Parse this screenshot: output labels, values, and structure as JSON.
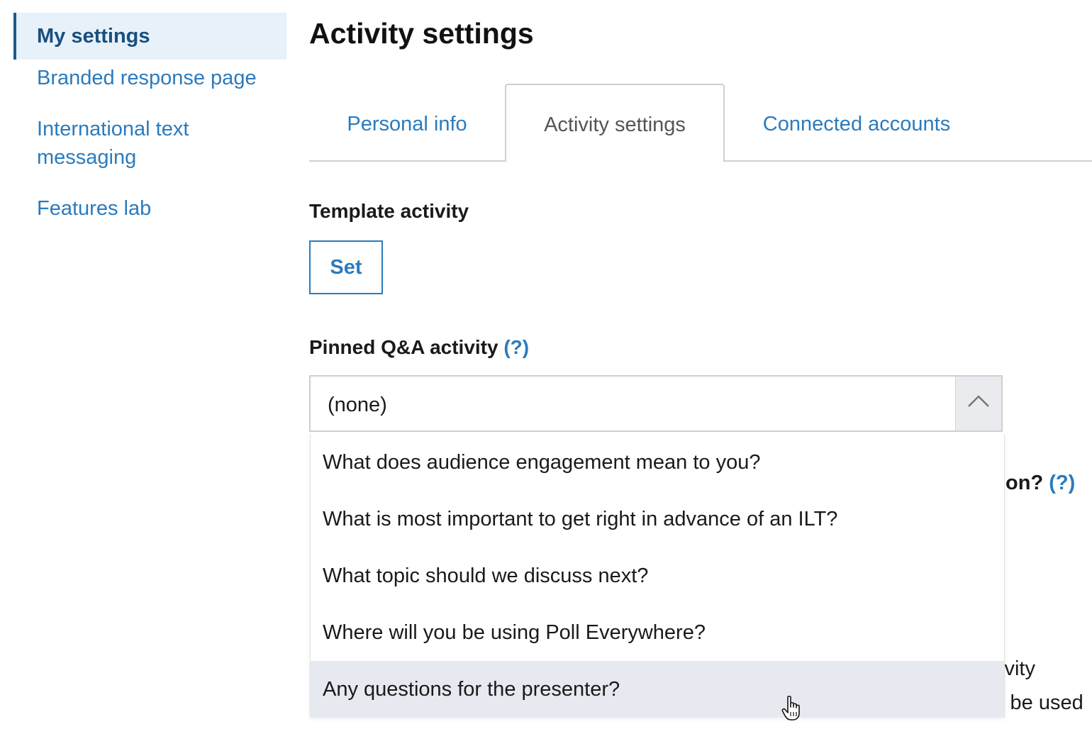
{
  "sidebar": {
    "items": [
      {
        "label": "My settings"
      },
      {
        "label": "Branded response page"
      },
      {
        "label": "International text messaging"
      },
      {
        "label": "Features lab"
      }
    ]
  },
  "page": {
    "title": "Activity settings"
  },
  "tabs": [
    {
      "label": "Personal info"
    },
    {
      "label": "Activity settings"
    },
    {
      "label": "Connected accounts"
    }
  ],
  "template_activity": {
    "label": "Template activity",
    "button_label": "Set"
  },
  "pinned_qa": {
    "label": "Pinned Q&A activity",
    "help": "(?)",
    "selected": "(none)",
    "options": [
      "What does audience engagement mean to you?",
      "What is most important to get right in advance of an ILT?",
      "What topic should we discuss next?",
      "Where will you be using Poll Everywhere?",
      "Any questions for the presenter?"
    ]
  },
  "obscured": {
    "fragment_1": "ion?",
    "fragment_1_help": "(?)",
    "fragment_2": "ivity",
    "fragment_3": "l be used"
  },
  "colors": {
    "link": "#2b7bbd",
    "active_sidebar_bg": "#e7f1f9",
    "option_hover_bg": "#e6e9ef"
  },
  "icons": {
    "select_toggle": "chevron-up-icon",
    "cursor": "hand-pointer-icon"
  }
}
